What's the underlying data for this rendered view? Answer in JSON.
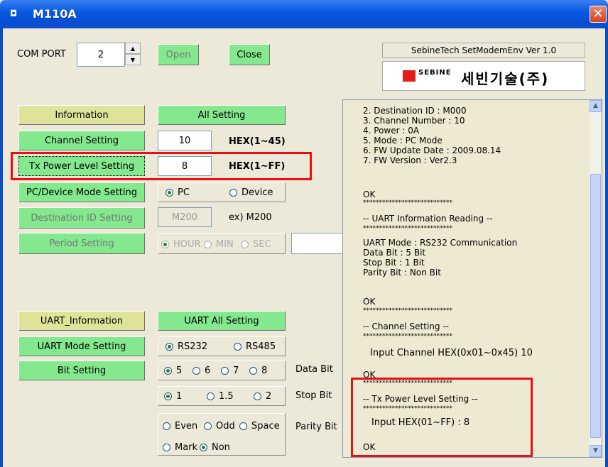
{
  "window": {
    "title": "M110A",
    "close": "✕"
  },
  "com": {
    "label": "COM PORT",
    "value": "2",
    "open": "Open",
    "close": "Close"
  },
  "brand": {
    "version": "SebineTech SetModemEnv  Ver 1.0",
    "logo_en": "SEBINE",
    "logo_ko": "세빈기술(주)"
  },
  "buttons": {
    "information": "Information",
    "all_setting": "All Setting",
    "channel_setting": "Channel Setting",
    "tx_power": "Tx Power Level Setting",
    "pc_device": "PC/Device Mode Setting",
    "dest_id": "Destination ID Setting",
    "period": "Period Setting",
    "uart_info": "UART_Information",
    "uart_all": "UART All Setting",
    "uart_mode": "UART Mode Setting",
    "bit_setting": "Bit Setting"
  },
  "fields": {
    "channel": {
      "value": "10",
      "hint": "HEX(1~45)"
    },
    "tx_power": {
      "value": "8",
      "hint": "HEX(1~FF)"
    },
    "dest_id": {
      "value": "M200",
      "hint": "ex) M200"
    }
  },
  "radios": {
    "pc": "PC",
    "device": "Device",
    "hour": "HOUR",
    "min": "MIN",
    "sec": "SEC",
    "rs232": "RS232",
    "rs485": "RS485",
    "d5": "5",
    "d6": "6",
    "d7": "7",
    "d8": "8",
    "data_bit": "Data Bit",
    "s1": "1",
    "s15": "1.5",
    "s2": "2",
    "stop_bit": "Stop Bit",
    "even": "Even",
    "odd": "Odd",
    "space": "Space",
    "mark": "Mark",
    "non": "Non",
    "parity_bit": "Parity Bit"
  },
  "log": {
    "block1": "2. Destination ID : M000\n3. Channel Number : 10\n4. Power : 0A\n5. Mode : PC Mode\n6. FW Update Date : 2009.08.14\n7. FW Version : Ver2.3",
    "ok1": "OK",
    "stars1": "****************************",
    "uart_title": "-- UART Information Reading --",
    "stars2": "****************************",
    "block2": "UART Mode : RS232 Communication\nData Bit : 5 Bit\nStop Bit : 1 Bit\nParity Bit : Non Bit",
    "ok2": "OK",
    "stars3": "****************************",
    "ch_title": "-- Channel Setting --",
    "stars4": "****************************",
    "ch_input": "Input Channel HEX(0x01~0x45) 10",
    "ok3": "OK",
    "stars5": "****************************",
    "tx_title": "-- Tx Power Level Setting --",
    "stars6": "****************************",
    "tx_input": "Input HEX(01~FF) : 8",
    "ok4": "OK"
  },
  "colors": {
    "title_bar": "#0a5ae0",
    "highlight": "#e81010",
    "button_green": "#83e88e",
    "button_yellow": "#dfe39a"
  }
}
